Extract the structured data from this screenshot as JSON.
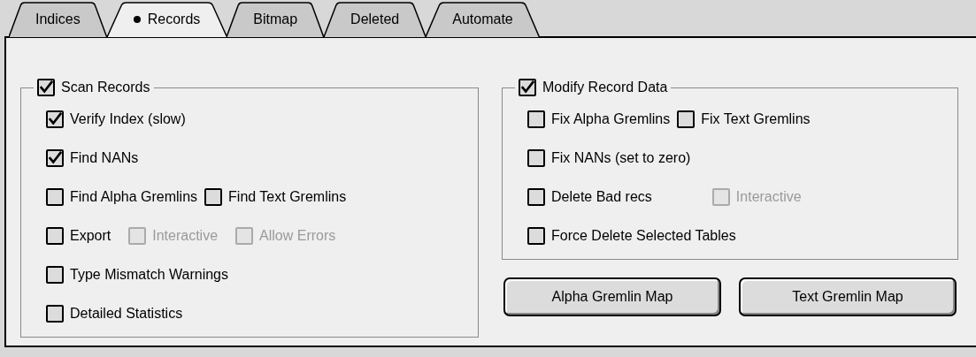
{
  "tabs": [
    {
      "label": "Indices",
      "selected": false
    },
    {
      "label": "Records",
      "selected": true
    },
    {
      "label": "Bitmap",
      "selected": false
    },
    {
      "label": "Deleted",
      "selected": false
    },
    {
      "label": "Automate",
      "selected": false
    }
  ],
  "groups": [
    {
      "title": {
        "label": "Scan Records",
        "checked": true
      },
      "rows": [
        {
          "items": [
            {
              "label": "Verify Index (slow)",
              "checked": true,
              "disabled": false
            }
          ]
        },
        {
          "items": [
            {
              "label": "Find NANs",
              "checked": true,
              "disabled": false
            }
          ]
        },
        {
          "items": [
            {
              "label": "Find Alpha Gremlins",
              "checked": false,
              "disabled": false
            },
            {
              "label": "Find Text Gremlins",
              "checked": false,
              "disabled": false
            }
          ]
        },
        {
          "items": [
            {
              "label": "Export",
              "checked": false,
              "disabled": false
            },
            {
              "label": "Interactive",
              "checked": false,
              "disabled": true
            },
            {
              "label": "Allow Errors",
              "checked": false,
              "disabled": true
            }
          ]
        },
        {
          "items": [
            {
              "label": "Type Mismatch Warnings",
              "checked": false,
              "disabled": false
            }
          ]
        },
        {
          "items": [
            {
              "label": "Detailed Statistics",
              "checked": false,
              "disabled": false
            }
          ]
        }
      ]
    },
    {
      "title": {
        "label": "Modify Record Data",
        "checked": true
      },
      "rows": [
        {
          "items": [
            {
              "label": "Fix Alpha Gremlins",
              "checked": false,
              "disabled": false
            },
            {
              "label": "Fix Text Gremlins",
              "checked": false,
              "disabled": false
            }
          ]
        },
        {
          "items": [
            {
              "label": "Fix NANs (set to zero)",
              "checked": false,
              "disabled": false
            }
          ]
        },
        {
          "items": [
            {
              "label": "Delete Bad recs",
              "checked": false,
              "disabled": false
            },
            {
              "label": "Interactive",
              "checked": false,
              "disabled": true
            }
          ]
        },
        {
          "items": [
            {
              "label": "Force Delete Selected Tables",
              "checked": false,
              "disabled": false
            }
          ]
        }
      ]
    }
  ],
  "buttons": [
    "Alpha Gremlin Map",
    "Text Gremlin Map"
  ]
}
